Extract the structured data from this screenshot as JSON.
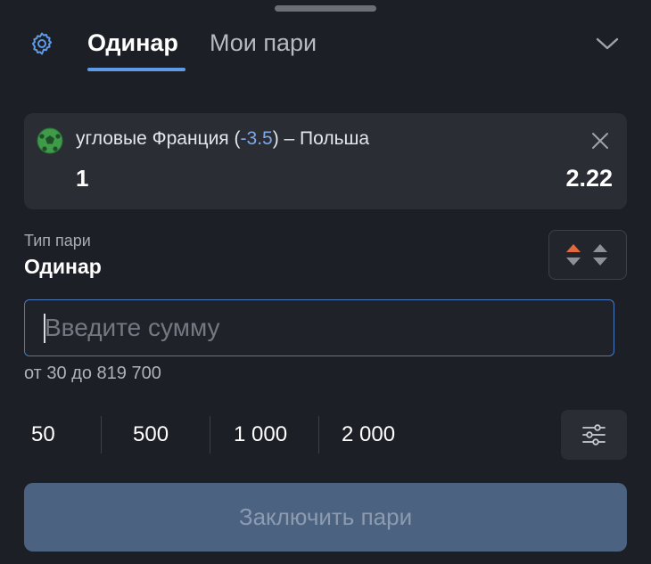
{
  "header": {
    "tabs": [
      {
        "label": "Одинар",
        "active": true
      },
      {
        "label": "Мои пари",
        "active": false
      }
    ]
  },
  "bet": {
    "event_prefix": "угловые Франция (",
    "handicap": "-3.5",
    "event_suffix": ") – Польша",
    "outcome": "1",
    "odds": "2.22"
  },
  "bet_type": {
    "label": "Тип пари",
    "value": "Одинар"
  },
  "amount": {
    "placeholder": "Введите сумму",
    "value": "",
    "limits": "от 30 до 819 700"
  },
  "quick_amounts": [
    "50",
    "500",
    "1 000",
    "2 000"
  ],
  "submit_label": "Заключить пари",
  "colors": {
    "accent": "#5f9ae6",
    "background": "#1c1f25",
    "card": "#2a2d33",
    "submit_disabled": "#4b6381",
    "odds_up": "#e06a3d"
  },
  "icons": {
    "settings": "gear-icon",
    "collapse": "chevron-down-icon",
    "sport": "football-icon",
    "remove": "close-icon",
    "odds_change": "odds-change-icon",
    "amount_settings": "sliders-icon"
  }
}
